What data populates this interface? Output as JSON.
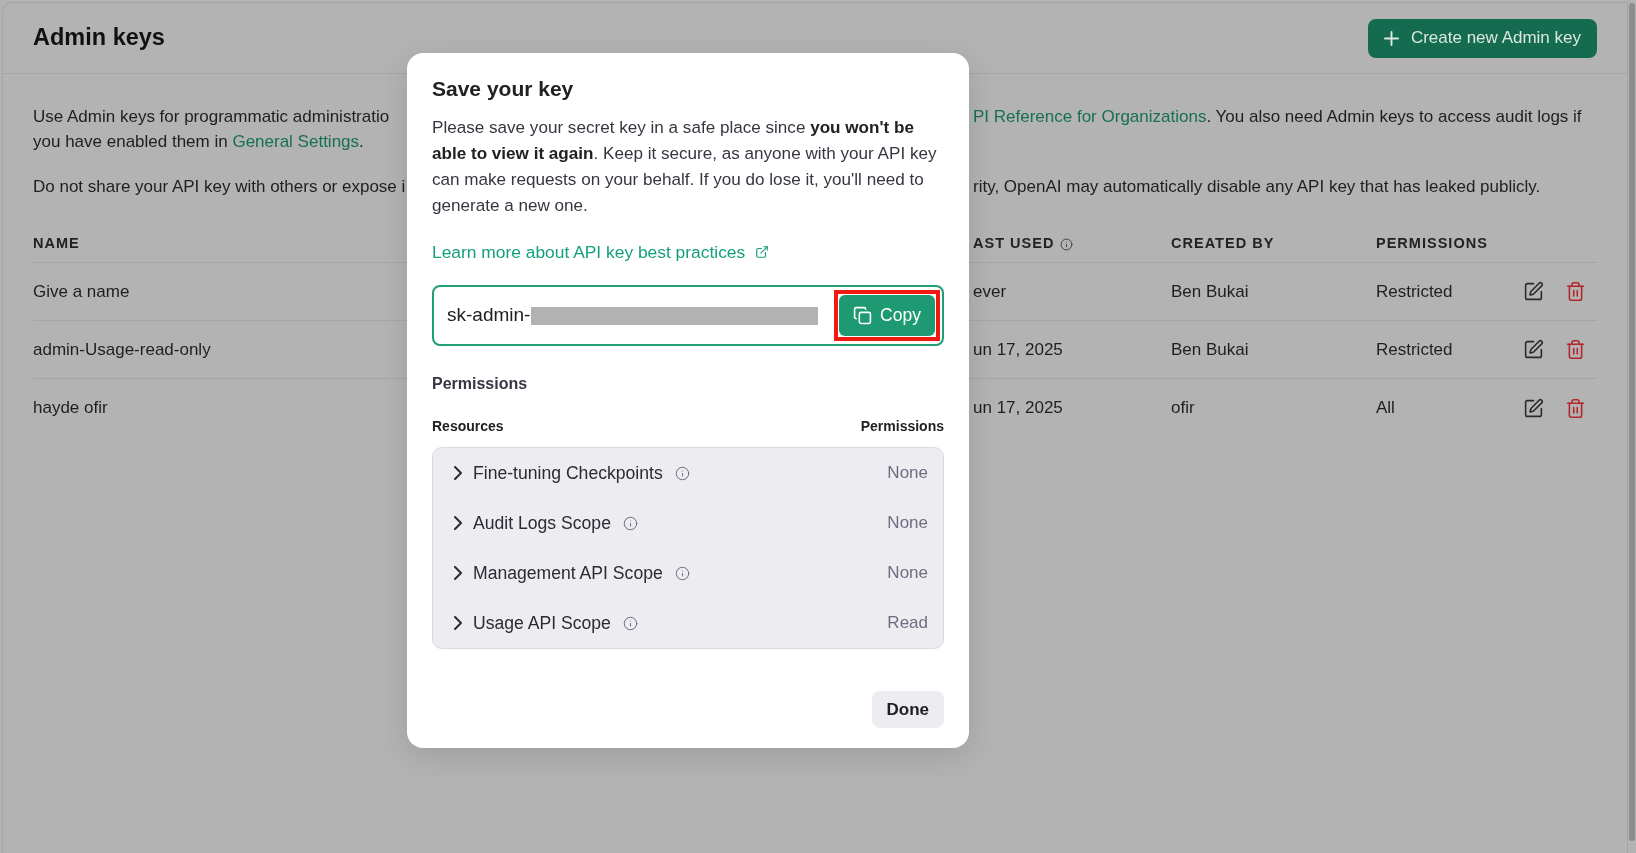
{
  "page": {
    "title": "Admin keys",
    "create_button": {
      "label": "Create new Admin key"
    }
  },
  "intro": [
    {
      "lines": [
        {
          "left": [
            {
              "kind": "text",
              "text": "Use Admin keys for programmatic administratio"
            }
          ],
          "right": [
            {
              "kind": "link",
              "text": "PI Reference for Organizations"
            },
            {
              "kind": "text",
              "text": ". You also need Admin keys to access audit logs if"
            }
          ]
        },
        {
          "left": [
            {
              "kind": "text",
              "text": "you have enabled them in "
            },
            {
              "kind": "link",
              "text": "General Settings"
            },
            {
              "kind": "text",
              "text": "."
            }
          ]
        }
      ]
    },
    {
      "lines": [
        {
          "left": [
            {
              "kind": "text",
              "text": "Do not share your API key with others or expose i"
            }
          ],
          "right": [
            {
              "kind": "text",
              "text": "rity, OpenAI may automatically disable any API key that has leaked publicly."
            }
          ]
        }
      ]
    }
  ],
  "table": {
    "columns": [
      {
        "label": "NAME",
        "hint": false
      },
      {
        "label": "AST USED",
        "hint": true
      },
      {
        "label": "CREATED BY",
        "hint": false
      },
      {
        "label": "PERMISSIONS",
        "hint": false
      }
    ],
    "rows": [
      {
        "name": "Give a name",
        "last_used": "ever",
        "created_by": "Ben Bukai",
        "permissions": "Restricted"
      },
      {
        "name": "admin-Usage-read-only",
        "last_used": "un 17, 2025",
        "created_by": "Ben Bukai",
        "permissions": "Restricted"
      },
      {
        "name": "hayde ofir",
        "last_used": "un 17, 2025",
        "created_by": "ofir",
        "permissions": "All"
      }
    ]
  },
  "dialog": {
    "title": "Save your key",
    "message": "Please save your secret key in a safe place since **you won't be able to view it again**. Keep it secure, as anyone with your API key can make requests on your behalf. If you do lose it, you'll need to generate a new one.",
    "link": "Learn more about API key best practices",
    "key_field": {
      "value": "sk-admin-",
      "redacted": true
    },
    "copy_button": {
      "label": "Copy",
      "highlighted": true
    },
    "permissions": {
      "title": "Permissions",
      "resources_label": "Resources",
      "permissions_label": "Permissions",
      "items": [
        {
          "label": "Fine-tuning Checkpoints",
          "value": "None",
          "expanded": false
        },
        {
          "label": "Audit Logs Scope",
          "value": "None",
          "expanded": false
        },
        {
          "label": "Management API Scope",
          "value": "None",
          "expanded": false
        },
        {
          "label": "Usage API Scope",
          "value": "Read",
          "expanded": false
        }
      ]
    },
    "done_button": {
      "label": "Done"
    }
  }
}
